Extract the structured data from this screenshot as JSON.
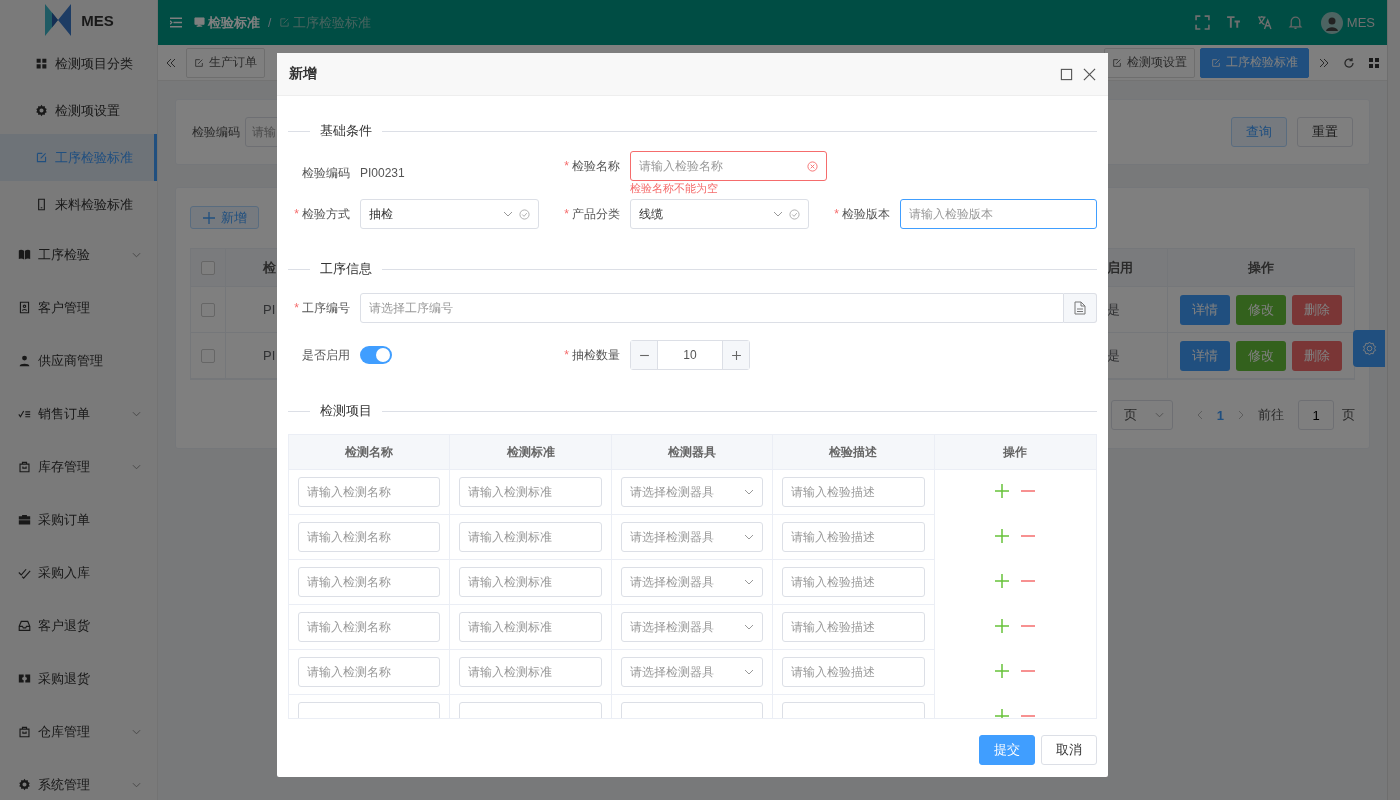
{
  "app": {
    "name": "MES"
  },
  "sidebar": {
    "items": [
      {
        "label": "检测项目分类",
        "kind": "sub",
        "selected": false,
        "expandable": false
      },
      {
        "label": "检测项设置",
        "kind": "sub",
        "selected": false,
        "expandable": false
      },
      {
        "label": "工序检验标准",
        "kind": "sub",
        "selected": true,
        "expandable": false
      },
      {
        "label": "来料检验标准",
        "kind": "sub",
        "selected": false,
        "expandable": false
      },
      {
        "label": "工序检验",
        "kind": "top",
        "selected": false,
        "expandable": true
      },
      {
        "label": "客户管理",
        "kind": "top",
        "selected": false,
        "expandable": false
      },
      {
        "label": "供应商管理",
        "kind": "top",
        "selected": false,
        "expandable": false
      },
      {
        "label": "销售订单",
        "kind": "top",
        "selected": false,
        "expandable": true
      },
      {
        "label": "库存管理",
        "kind": "top",
        "selected": false,
        "expandable": true
      },
      {
        "label": "采购订单",
        "kind": "top",
        "selected": false,
        "expandable": false
      },
      {
        "label": "采购入库",
        "kind": "top",
        "selected": false,
        "expandable": false
      },
      {
        "label": "客户退货",
        "kind": "top",
        "selected": false,
        "expandable": false
      },
      {
        "label": "采购退货",
        "kind": "top",
        "selected": false,
        "expandable": false
      },
      {
        "label": "仓库管理",
        "kind": "top",
        "selected": false,
        "expandable": true
      },
      {
        "label": "系统管理",
        "kind": "top",
        "selected": false,
        "expandable": true
      }
    ]
  },
  "header": {
    "breadcrumb": [
      {
        "label": "检验标准",
        "current": false
      },
      {
        "label": "工序检验标准",
        "current": true
      }
    ],
    "separator": "/",
    "user": "MES"
  },
  "tabs": [
    {
      "label": "生产订单",
      "selected": false
    },
    {
      "label": "检测项设置",
      "selected": false
    },
    {
      "label": "工序检验标准",
      "selected": true
    }
  ],
  "search": {
    "label": "检验编码",
    "placeholder": "请输",
    "buttons": [
      {
        "label": "查询",
        "kind": "primary"
      },
      {
        "label": "重置",
        "kind": "default"
      }
    ]
  },
  "list": {
    "add": "新增",
    "all_checked": false,
    "columns": [
      "检",
      "启用",
      "操作"
    ],
    "rows": [
      {
        "checked": false,
        "code": "PI",
        "enabled": "是",
        "actions": [
          {
            "label": "详情",
            "kind": "info"
          },
          {
            "label": "修改",
            "kind": "edit"
          },
          {
            "label": "删除",
            "kind": "delete"
          }
        ]
      },
      {
        "checked": false,
        "code": "PI",
        "enabled": "是",
        "actions": [
          {
            "label": "详情",
            "kind": "info"
          },
          {
            "label": "修改",
            "kind": "edit"
          },
          {
            "label": "删除",
            "kind": "delete"
          }
        ]
      }
    ],
    "pagination": {
      "size": "页",
      "page": "1",
      "goto": "前往",
      "goto_value": "1",
      "suffix": "页"
    }
  },
  "dialog": {
    "title": "新增",
    "basic": {
      "title": "基础条件",
      "code": {
        "label": "检验编码",
        "value": "PI00231"
      },
      "name": {
        "mark": "*",
        "label": "检验名称",
        "placeholder": "请输入检验名称",
        "error": "检验名称不能为空"
      },
      "method": {
        "mark": "*",
        "label": "检验方式",
        "value": "抽检"
      },
      "category": {
        "mark": "*",
        "label": "产品分类",
        "value": "线缆"
      },
      "version": {
        "mark": "*",
        "label": "检验版本",
        "placeholder": "请输入检验版本",
        "focused": true
      }
    },
    "process": {
      "title": "工序信息",
      "number": {
        "mark": "*",
        "label": "工序编号",
        "placeholder": "请选择工序编号"
      },
      "enabled": {
        "label": "是否启用",
        "on": true
      },
      "quantity": {
        "mark": "*",
        "label": "抽检数量",
        "value": "10"
      }
    },
    "items": {
      "title": "检测项目",
      "columns": [
        "检测名称",
        "检测标准",
        "检测器具",
        "检验描述",
        "操作"
      ],
      "rows": [
        {
          "name": {
            "placeholder": "请输入检测名称"
          },
          "standard": {
            "placeholder": "请输入检测标准"
          },
          "tool": {
            "placeholder": "请选择检测器具"
          },
          "description": {
            "placeholder": "请输入检验描述"
          }
        },
        {
          "name": {
            "placeholder": "请输入检测名称"
          },
          "standard": {
            "placeholder": "请输入检测标准"
          },
          "tool": {
            "placeholder": "请选择检测器具"
          },
          "description": {
            "placeholder": "请输入检验描述"
          }
        },
        {
          "name": {
            "placeholder": "请输入检测名称"
          },
          "standard": {
            "placeholder": "请输入检测标准"
          },
          "tool": {
            "placeholder": "请选择检测器具"
          },
          "description": {
            "placeholder": "请输入检验描述"
          }
        },
        {
          "name": {
            "placeholder": "请输入检测名称"
          },
          "standard": {
            "placeholder": "请输入检测标准"
          },
          "tool": {
            "placeholder": "请选择检测器具"
          },
          "description": {
            "placeholder": "请输入检验描述"
          }
        },
        {
          "name": {
            "placeholder": "请输入检测名称"
          },
          "standard": {
            "placeholder": "请输入检测标准"
          },
          "tool": {
            "placeholder": "请选择检测器具"
          },
          "description": {
            "placeholder": "请输入检验描述"
          }
        }
      ]
    },
    "buttons": [
      {
        "label": "提交",
        "kind": "primary"
      },
      {
        "label": "取消",
        "kind": "default"
      }
    ]
  }
}
